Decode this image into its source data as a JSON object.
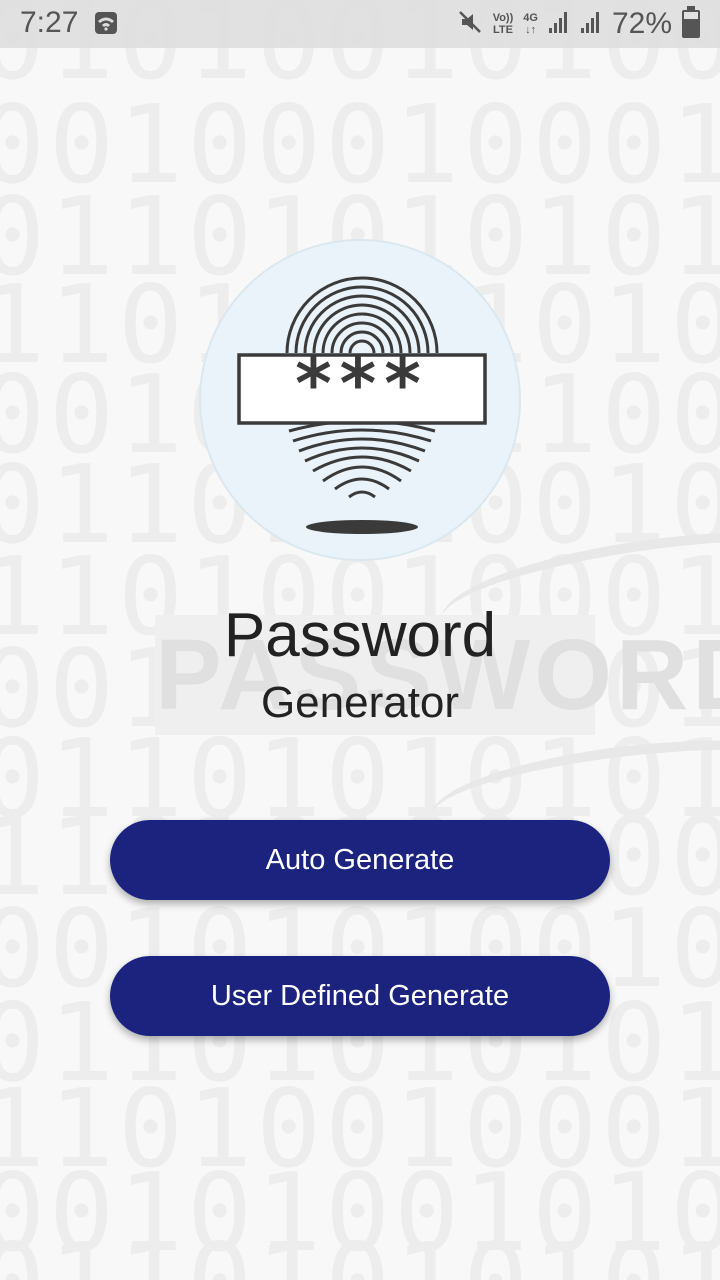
{
  "status_bar": {
    "time": "7:27",
    "volte_top": "Vo))",
    "volte_bottom": "LTE",
    "net_top": "4G",
    "net_bottom": "↓↑",
    "battery_percent": "72%",
    "battery_level": 0.72
  },
  "background": {
    "binary_rows": [
      "0101001010001",
      "0010001000101",
      "0110101010101",
      "1101010101001",
      "0010100110001",
      "0110101001010",
      "1101001000100",
      "0010101000110",
      "0110101010101",
      "1101010010001",
      "0010101001000",
      "0110101010101",
      "1101001000100",
      "0010100101001",
      "0110101010101"
    ],
    "watermark_text": "PASSWORD"
  },
  "logo": {
    "icon": "fingerprint-password-icon",
    "mask": "***"
  },
  "title": "Password",
  "subtitle": "Generator",
  "buttons": {
    "auto_generate": "Auto Generate",
    "user_defined_generate": "User Defined Generate",
    "color": "#1b237e"
  }
}
